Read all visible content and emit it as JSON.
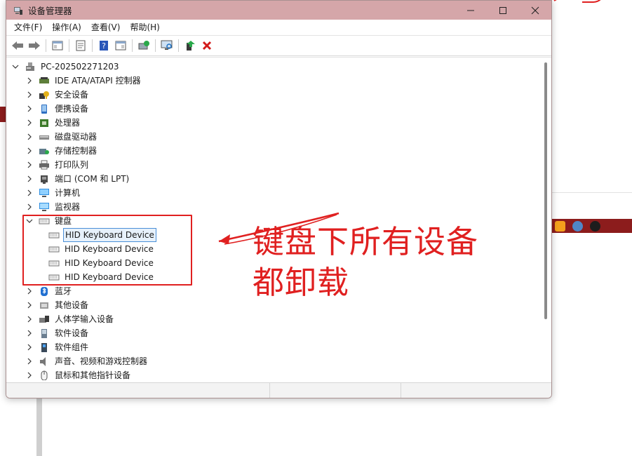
{
  "window": {
    "title": "设备管理器"
  },
  "menu": [
    "文件(F)",
    "操作(A)",
    "查看(V)",
    "帮助(H)"
  ],
  "toolbar": [
    "back-icon",
    "forward-icon",
    "show-hide-tree-icon",
    "properties-icon",
    "help-icon",
    "view-icon",
    "update-driver-icon",
    "scan-hardware-icon",
    "enable-device-icon",
    "uninstall-icon"
  ],
  "tree": {
    "root": "PC-202502271203",
    "categories": [
      {
        "label": "IDE ATA/ATAPI 控制器",
        "icon": "ide-controller-icon"
      },
      {
        "label": "安全设备",
        "icon": "security-device-icon"
      },
      {
        "label": "便携设备",
        "icon": "portable-device-icon"
      },
      {
        "label": "处理器",
        "icon": "processor-icon"
      },
      {
        "label": "磁盘驱动器",
        "icon": "disk-drive-icon"
      },
      {
        "label": "存储控制器",
        "icon": "storage-controller-icon"
      },
      {
        "label": "打印队列",
        "icon": "printer-icon"
      },
      {
        "label": "端口 (COM 和 LPT)",
        "icon": "port-icon"
      },
      {
        "label": "计算机",
        "icon": "computer-icon"
      },
      {
        "label": "监视器",
        "icon": "monitor-icon"
      },
      {
        "label": "键盘",
        "icon": "keyboard-icon",
        "expanded": true,
        "children": [
          "HID Keyboard Device",
          "HID Keyboard Device",
          "HID Keyboard Device",
          "HID Keyboard Device"
        ]
      },
      {
        "label": "蓝牙",
        "icon": "bluetooth-icon"
      },
      {
        "label": "其他设备",
        "icon": "other-device-icon"
      },
      {
        "label": "人体学输入设备",
        "icon": "hid-icon"
      },
      {
        "label": "软件设备",
        "icon": "software-device-icon"
      },
      {
        "label": "软件组件",
        "icon": "software-component-icon"
      },
      {
        "label": "声音、视频和游戏控制器",
        "icon": "sound-icon"
      },
      {
        "label": "鼠标和其他指针设备",
        "icon": "mouse-icon"
      }
    ]
  },
  "annotation": {
    "line1": "键盘下所有设备",
    "line2": "都卸载",
    "color": "#e02020"
  },
  "colors": {
    "titlebar": "#d5a6a9",
    "selection_border": "#4a8fd8",
    "taskbar": "#8c1c1c"
  }
}
